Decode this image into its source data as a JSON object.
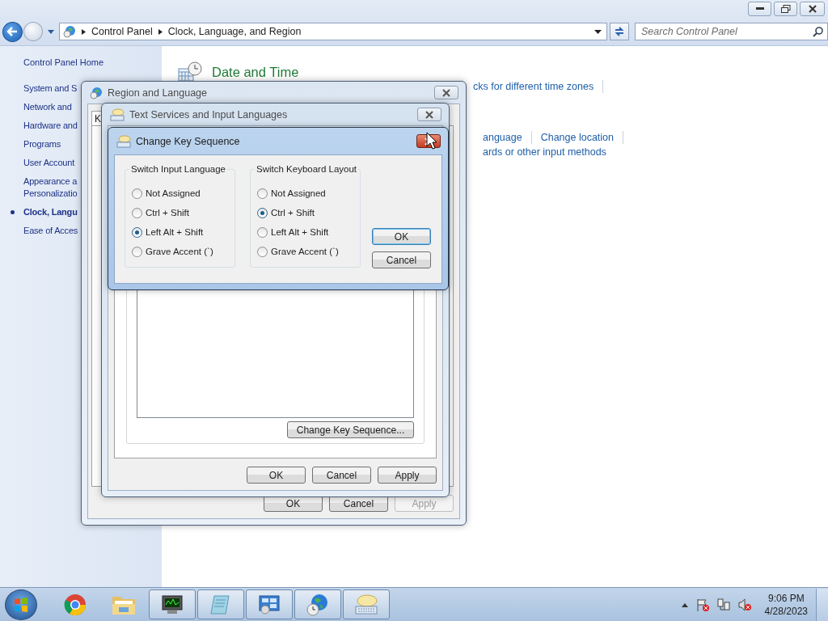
{
  "address_bar": {
    "breadcrumbs": [
      "Control Panel",
      "Clock, Language, and Region"
    ]
  },
  "search": {
    "placeholder": "Search Control Panel"
  },
  "sidebar": {
    "home": "Control Panel Home",
    "items": [
      {
        "lines": [
          "System and S"
        ],
        "selected": false
      },
      {
        "lines": [
          "Network and"
        ],
        "selected": false
      },
      {
        "lines": [
          "Hardware and"
        ],
        "selected": false
      },
      {
        "lines": [
          "Programs"
        ],
        "selected": false
      },
      {
        "lines": [
          "User Account"
        ],
        "selected": false
      },
      {
        "lines": [
          "Appearance a",
          "Personalizatio"
        ],
        "selected": false
      },
      {
        "lines": [
          "Clock, Langu"
        ],
        "selected": true
      },
      {
        "lines": [
          "Ease of Acces"
        ],
        "selected": false
      }
    ]
  },
  "content": {
    "heading": "Date and Time",
    "link_rows": [
      {
        "links": [
          "cks for different time zones"
        ]
      },
      {
        "links": [
          "anguage",
          "Change location"
        ]
      },
      {
        "links": [
          "ards or other input methods"
        ]
      }
    ]
  },
  "region_dialog": {
    "title": "Region and Language",
    "tabs": [
      "K"
    ],
    "buttons": [
      {
        "label": "OK",
        "disabled": false
      },
      {
        "label": "Cancel",
        "disabled": false
      },
      {
        "label": "Apply",
        "disabled": true
      }
    ]
  },
  "text_services_dialog": {
    "title": "Text Services and Input Languages",
    "change_button": "Change Key Sequence...",
    "buttons": [
      {
        "label": "OK",
        "disabled": false
      },
      {
        "label": "Cancel",
        "disabled": false
      },
      {
        "label": "Apply",
        "disabled": false
      }
    ]
  },
  "key_dialog": {
    "title": "Change Key Sequence",
    "groups": [
      {
        "title": "Switch Input Language",
        "options": [
          {
            "label": "Not Assigned",
            "selected": false
          },
          {
            "label": "Ctrl + Shift",
            "selected": false
          },
          {
            "label": "Left Alt + Shift",
            "selected": true
          },
          {
            "label": "Grave Accent (`)",
            "selected": false
          }
        ]
      },
      {
        "title": "Switch Keyboard Layout",
        "options": [
          {
            "label": "Not Assigned",
            "selected": false
          },
          {
            "label": "Ctrl + Shift",
            "selected": true
          },
          {
            "label": "Left Alt + Shift",
            "selected": false
          },
          {
            "label": "Grave Accent (`)",
            "selected": false
          }
        ]
      }
    ],
    "buttons": [
      {
        "label": "OK",
        "default": true
      },
      {
        "label": "Cancel",
        "default": false
      }
    ]
  },
  "taskbar": {
    "apps": [
      {
        "kind": "browser",
        "running": false
      },
      {
        "kind": "folder",
        "running": false
      },
      {
        "kind": "monitor",
        "running": true
      },
      {
        "kind": "notepad",
        "running": true
      },
      {
        "kind": "control-panel",
        "running": true
      },
      {
        "kind": "globe-clock",
        "running": true
      },
      {
        "kind": "keyboard",
        "running": true
      }
    ],
    "tray": [
      {
        "kind": "up-arrow"
      },
      {
        "kind": "flag"
      },
      {
        "kind": "network"
      },
      {
        "kind": "speaker-muted"
      }
    ],
    "time": "9:06 PM",
    "date": "4/28/2023"
  }
}
